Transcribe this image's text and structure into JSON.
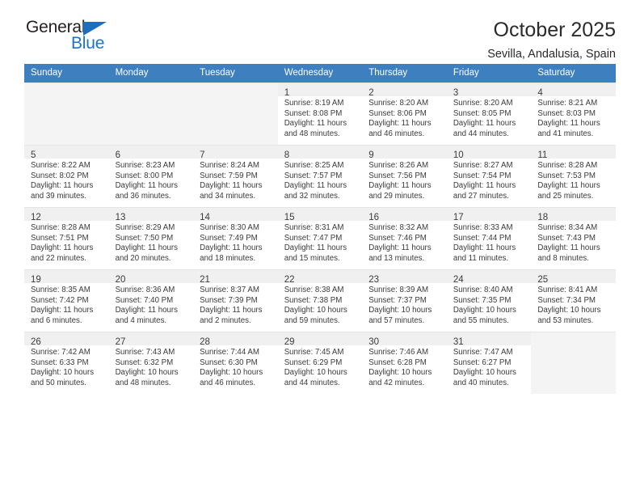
{
  "brand": {
    "name_top": "General",
    "name_bottom": "Blue",
    "accent_color": "#1b74c9",
    "triangle_color": "#1b6fc0"
  },
  "header": {
    "title": "October 2025",
    "subtitle": "Sevilla, Andalusia, Spain"
  },
  "theme": {
    "header_row_bg": "#3d7fbf",
    "header_row_text": "#ffffff",
    "daynum_bar_bg": "#f0f0f0",
    "empty_cell_bg": "#f4f4f4",
    "grid_line": "#e4e4e4",
    "body_text": "#3a3a3a"
  },
  "weekday_headers": [
    "Sunday",
    "Monday",
    "Tuesday",
    "Wednesday",
    "Thursday",
    "Friday",
    "Saturday"
  ],
  "weeks": [
    [
      {
        "day": "",
        "sunrise": "",
        "sunset": "",
        "daylight_line1": "",
        "daylight_line2": "",
        "empty": true
      },
      {
        "day": "",
        "sunrise": "",
        "sunset": "",
        "daylight_line1": "",
        "daylight_line2": "",
        "empty": true
      },
      {
        "day": "",
        "sunrise": "",
        "sunset": "",
        "daylight_line1": "",
        "daylight_line2": "",
        "empty": true
      },
      {
        "day": "1",
        "sunrise": "Sunrise: 8:19 AM",
        "sunset": "Sunset: 8:08 PM",
        "daylight_line1": "Daylight: 11 hours",
        "daylight_line2": "and 48 minutes.",
        "empty": false
      },
      {
        "day": "2",
        "sunrise": "Sunrise: 8:20 AM",
        "sunset": "Sunset: 8:06 PM",
        "daylight_line1": "Daylight: 11 hours",
        "daylight_line2": "and 46 minutes.",
        "empty": false
      },
      {
        "day": "3",
        "sunrise": "Sunrise: 8:20 AM",
        "sunset": "Sunset: 8:05 PM",
        "daylight_line1": "Daylight: 11 hours",
        "daylight_line2": "and 44 minutes.",
        "empty": false
      },
      {
        "day": "4",
        "sunrise": "Sunrise: 8:21 AM",
        "sunset": "Sunset: 8:03 PM",
        "daylight_line1": "Daylight: 11 hours",
        "daylight_line2": "and 41 minutes.",
        "empty": false
      }
    ],
    [
      {
        "day": "5",
        "sunrise": "Sunrise: 8:22 AM",
        "sunset": "Sunset: 8:02 PM",
        "daylight_line1": "Daylight: 11 hours",
        "daylight_line2": "and 39 minutes.",
        "empty": false
      },
      {
        "day": "6",
        "sunrise": "Sunrise: 8:23 AM",
        "sunset": "Sunset: 8:00 PM",
        "daylight_line1": "Daylight: 11 hours",
        "daylight_line2": "and 36 minutes.",
        "empty": false
      },
      {
        "day": "7",
        "sunrise": "Sunrise: 8:24 AM",
        "sunset": "Sunset: 7:59 PM",
        "daylight_line1": "Daylight: 11 hours",
        "daylight_line2": "and 34 minutes.",
        "empty": false
      },
      {
        "day": "8",
        "sunrise": "Sunrise: 8:25 AM",
        "sunset": "Sunset: 7:57 PM",
        "daylight_line1": "Daylight: 11 hours",
        "daylight_line2": "and 32 minutes.",
        "empty": false
      },
      {
        "day": "9",
        "sunrise": "Sunrise: 8:26 AM",
        "sunset": "Sunset: 7:56 PM",
        "daylight_line1": "Daylight: 11 hours",
        "daylight_line2": "and 29 minutes.",
        "empty": false
      },
      {
        "day": "10",
        "sunrise": "Sunrise: 8:27 AM",
        "sunset": "Sunset: 7:54 PM",
        "daylight_line1": "Daylight: 11 hours",
        "daylight_line2": "and 27 minutes.",
        "empty": false
      },
      {
        "day": "11",
        "sunrise": "Sunrise: 8:28 AM",
        "sunset": "Sunset: 7:53 PM",
        "daylight_line1": "Daylight: 11 hours",
        "daylight_line2": "and 25 minutes.",
        "empty": false
      }
    ],
    [
      {
        "day": "12",
        "sunrise": "Sunrise: 8:28 AM",
        "sunset": "Sunset: 7:51 PM",
        "daylight_line1": "Daylight: 11 hours",
        "daylight_line2": "and 22 minutes.",
        "empty": false
      },
      {
        "day": "13",
        "sunrise": "Sunrise: 8:29 AM",
        "sunset": "Sunset: 7:50 PM",
        "daylight_line1": "Daylight: 11 hours",
        "daylight_line2": "and 20 minutes.",
        "empty": false
      },
      {
        "day": "14",
        "sunrise": "Sunrise: 8:30 AM",
        "sunset": "Sunset: 7:49 PM",
        "daylight_line1": "Daylight: 11 hours",
        "daylight_line2": "and 18 minutes.",
        "empty": false
      },
      {
        "day": "15",
        "sunrise": "Sunrise: 8:31 AM",
        "sunset": "Sunset: 7:47 PM",
        "daylight_line1": "Daylight: 11 hours",
        "daylight_line2": "and 15 minutes.",
        "empty": false
      },
      {
        "day": "16",
        "sunrise": "Sunrise: 8:32 AM",
        "sunset": "Sunset: 7:46 PM",
        "daylight_line1": "Daylight: 11 hours",
        "daylight_line2": "and 13 minutes.",
        "empty": false
      },
      {
        "day": "17",
        "sunrise": "Sunrise: 8:33 AM",
        "sunset": "Sunset: 7:44 PM",
        "daylight_line1": "Daylight: 11 hours",
        "daylight_line2": "and 11 minutes.",
        "empty": false
      },
      {
        "day": "18",
        "sunrise": "Sunrise: 8:34 AM",
        "sunset": "Sunset: 7:43 PM",
        "daylight_line1": "Daylight: 11 hours",
        "daylight_line2": "and 8 minutes.",
        "empty": false
      }
    ],
    [
      {
        "day": "19",
        "sunrise": "Sunrise: 8:35 AM",
        "sunset": "Sunset: 7:42 PM",
        "daylight_line1": "Daylight: 11 hours",
        "daylight_line2": "and 6 minutes.",
        "empty": false
      },
      {
        "day": "20",
        "sunrise": "Sunrise: 8:36 AM",
        "sunset": "Sunset: 7:40 PM",
        "daylight_line1": "Daylight: 11 hours",
        "daylight_line2": "and 4 minutes.",
        "empty": false
      },
      {
        "day": "21",
        "sunrise": "Sunrise: 8:37 AM",
        "sunset": "Sunset: 7:39 PM",
        "daylight_line1": "Daylight: 11 hours",
        "daylight_line2": "and 2 minutes.",
        "empty": false
      },
      {
        "day": "22",
        "sunrise": "Sunrise: 8:38 AM",
        "sunset": "Sunset: 7:38 PM",
        "daylight_line1": "Daylight: 10 hours",
        "daylight_line2": "and 59 minutes.",
        "empty": false
      },
      {
        "day": "23",
        "sunrise": "Sunrise: 8:39 AM",
        "sunset": "Sunset: 7:37 PM",
        "daylight_line1": "Daylight: 10 hours",
        "daylight_line2": "and 57 minutes.",
        "empty": false
      },
      {
        "day": "24",
        "sunrise": "Sunrise: 8:40 AM",
        "sunset": "Sunset: 7:35 PM",
        "daylight_line1": "Daylight: 10 hours",
        "daylight_line2": "and 55 minutes.",
        "empty": false
      },
      {
        "day": "25",
        "sunrise": "Sunrise: 8:41 AM",
        "sunset": "Sunset: 7:34 PM",
        "daylight_line1": "Daylight: 10 hours",
        "daylight_line2": "and 53 minutes.",
        "empty": false
      }
    ],
    [
      {
        "day": "26",
        "sunrise": "Sunrise: 7:42 AM",
        "sunset": "Sunset: 6:33 PM",
        "daylight_line1": "Daylight: 10 hours",
        "daylight_line2": "and 50 minutes.",
        "empty": false
      },
      {
        "day": "27",
        "sunrise": "Sunrise: 7:43 AM",
        "sunset": "Sunset: 6:32 PM",
        "daylight_line1": "Daylight: 10 hours",
        "daylight_line2": "and 48 minutes.",
        "empty": false
      },
      {
        "day": "28",
        "sunrise": "Sunrise: 7:44 AM",
        "sunset": "Sunset: 6:30 PM",
        "daylight_line1": "Daylight: 10 hours",
        "daylight_line2": "and 46 minutes.",
        "empty": false
      },
      {
        "day": "29",
        "sunrise": "Sunrise: 7:45 AM",
        "sunset": "Sunset: 6:29 PM",
        "daylight_line1": "Daylight: 10 hours",
        "daylight_line2": "and 44 minutes.",
        "empty": false
      },
      {
        "day": "30",
        "sunrise": "Sunrise: 7:46 AM",
        "sunset": "Sunset: 6:28 PM",
        "daylight_line1": "Daylight: 10 hours",
        "daylight_line2": "and 42 minutes.",
        "empty": false
      },
      {
        "day": "31",
        "sunrise": "Sunrise: 7:47 AM",
        "sunset": "Sunset: 6:27 PM",
        "daylight_line1": "Daylight: 10 hours",
        "daylight_line2": "and 40 minutes.",
        "empty": false
      },
      {
        "day": "",
        "sunrise": "",
        "sunset": "",
        "daylight_line1": "",
        "daylight_line2": "",
        "empty": true
      }
    ]
  ]
}
